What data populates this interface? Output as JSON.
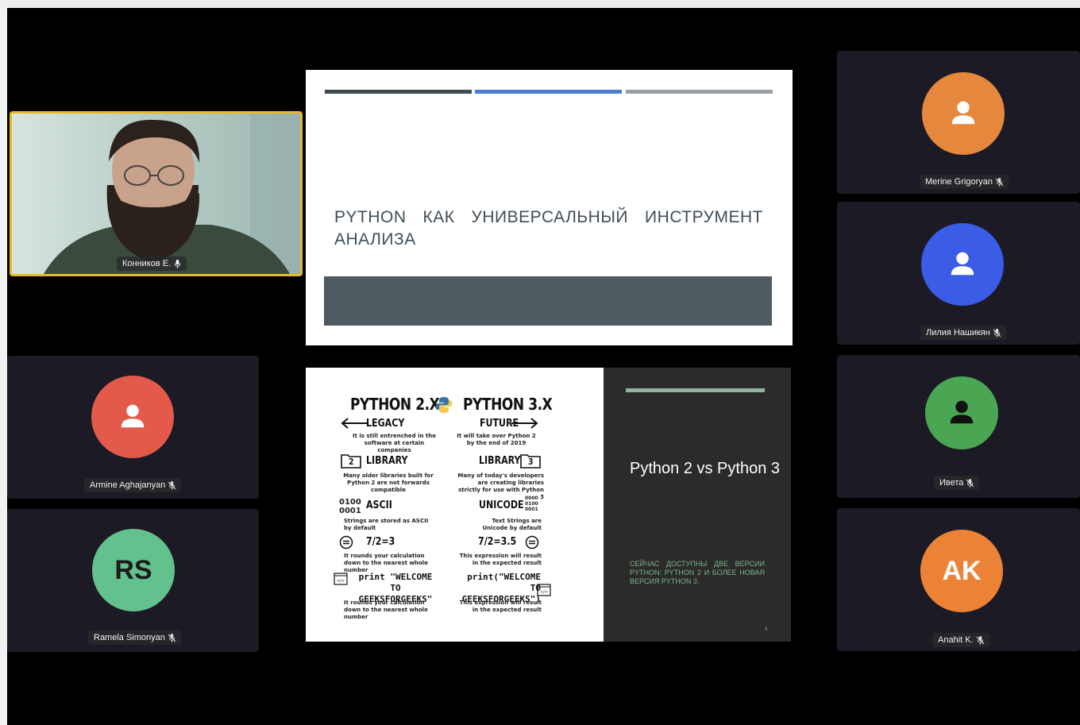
{
  "participants": {
    "speaker": {
      "name": "Конников Е."
    },
    "merine": {
      "name": "Merine Grigoryan",
      "color": "#e5873d"
    },
    "liliya": {
      "name": "Лилия Нашикян",
      "color": "#3a5ce6"
    },
    "armine": {
      "name": "Armine Aghajanyan",
      "color": "#e35a4b"
    },
    "iveta": {
      "name": "Ивета",
      "color": "#4aa652"
    },
    "ramela": {
      "name": "Ramela Simonyan",
      "initials": "RS",
      "color": "#62c18d"
    },
    "anahit": {
      "name": "Anahit K.",
      "initials": "AK",
      "color": "#ec8236"
    }
  },
  "slide1": {
    "title": "Python как универсальный инструмент анализа",
    "bar_colors": [
      "#3e4a52",
      "#4a7fcf",
      "#9a9fa3"
    ]
  },
  "slide2": {
    "title": "Python 2 vs Python 3",
    "subtitle": "Сейчас доступны две версии Python: Python 2 и более новая версия Python 3.",
    "page_number": "3",
    "infographic": {
      "left_header": "PYTHON 2.X",
      "right_header": "PYTHON 3.X",
      "legacy": "LEGACY",
      "future": "FUTURE",
      "legacy_desc": "It is still entrenched in the software at certain companies",
      "future_desc": "It will take over Python 2 by the end of 2019",
      "library_left": "LIBRARY",
      "library_right": "LIBRARY",
      "library_left_num": "2",
      "library_right_num": "3",
      "library_left_desc": "Many older libraries built for Python 2 are not forwards compatible",
      "library_right_desc": "Many of today's developers are creating libraries strictly for use with Python 3",
      "ascii": "ASCII",
      "unicode": "UNICODE",
      "binary_left": "0100\n0001",
      "binary_right": "0000\n0100\n0001",
      "ascii_desc": "Strings are stored as ASCII by default",
      "unicode_desc": "Text Strings are Unicode by default",
      "div_left": "7/2=3",
      "div_right": "7/2=3.5",
      "div_left_desc": "It rounds your calculation down to the nearest whole number",
      "div_right_desc": "This expression will result in the expected result",
      "print_left": "print \"WELCOME TO GEEKSFORGEEKS\"",
      "print_right": "print(\"WELCOME TO GEEKSFORGEEKS\")",
      "print_left_desc": "It rounds your calculation down to the nearest whole number",
      "print_right_desc": "This expression will result in the expected result"
    }
  }
}
